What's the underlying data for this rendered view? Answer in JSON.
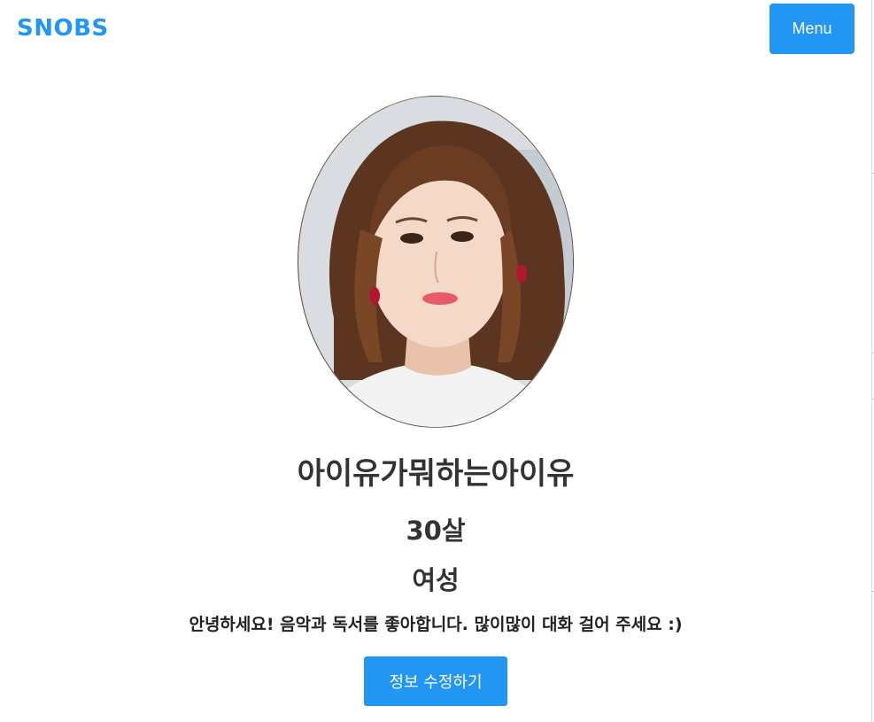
{
  "header": {
    "brand": "SNOBS",
    "menu_label": "Menu"
  },
  "profile": {
    "name": "아이유가뭐하는아이유",
    "age": "30살",
    "gender": "여성",
    "bio": "안녕하세요! 음악과 독서를 좋아합니다. 많이많이 대화 걸어 주세요 :)",
    "edit_label": "정보 수정하기"
  },
  "colors": {
    "accent": "#2196f3",
    "text": "#333333"
  }
}
